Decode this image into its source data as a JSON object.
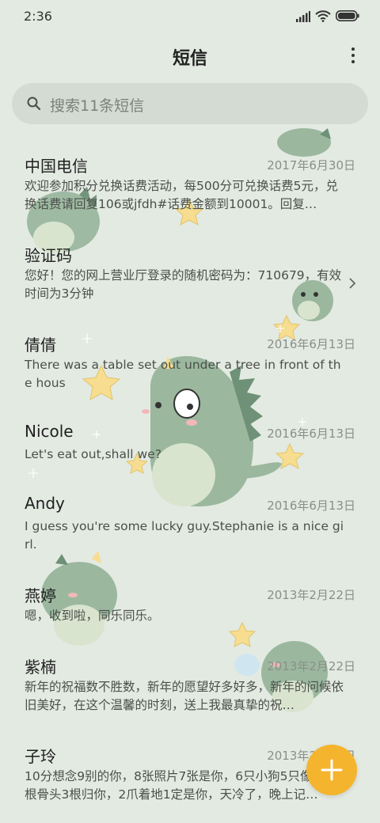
{
  "status_bar": {
    "time": "2:36",
    "icons": [
      "signal-icon",
      "wifi-icon",
      "battery-icon"
    ]
  },
  "header": {
    "title": "短信",
    "more_icon": "more-vertical-icon"
  },
  "search": {
    "placeholder": "搜索11条短信",
    "icon": "search-icon"
  },
  "messages": [
    {
      "name": "中国电信",
      "date": "2017年6月30日",
      "preview": "欢迎参加积分兑换话费活动，每500分可兑换话费5元，兑换话费请回复106或jfdh#话费金额到10001。回复…"
    },
    {
      "name": "验证码",
      "date": "",
      "preview": "您好！您的网上营业厅登录的随机密码为：710679，有效时间为3分钟"
    },
    {
      "name": "倩倩",
      "date": "2016年6月13日",
      "preview": "There was a table set out under a tree in front of the hous"
    },
    {
      "name": "Nicole",
      "date": "2016年6月13日",
      "preview": "Let's eat out,shall we?"
    },
    {
      "name": "Andy",
      "date": "2016年6月13日",
      "preview": "I guess you're some lucky guy.Stephanie is a nice girl."
    },
    {
      "name": "燕婷",
      "date": "2013年2月22日",
      "preview": "嗯，收到啦，同乐同乐。"
    },
    {
      "name": "紫楠",
      "date": "2013年2月22日",
      "preview": "新年的祝福数不胜数，新年的愿望好多好多，新年的问候依旧美好，在这个温馨的时刻，送上我最真挚的祝…"
    },
    {
      "name": "子玲",
      "date": "2013年2月22日",
      "preview": "10分想念9别的你，8张照片7张是你，6只小狗5只像你，4根骨头3根归你，2爪着地1定是你，天冷了，晚上记…"
    }
  ],
  "fab": {
    "icon": "plus-icon",
    "color": "#f5b42d"
  },
  "colors": {
    "background": "#e3eae2",
    "search_bg": "#d3dbd2",
    "accent": "#f5b42d",
    "dino": "#8fae95"
  }
}
